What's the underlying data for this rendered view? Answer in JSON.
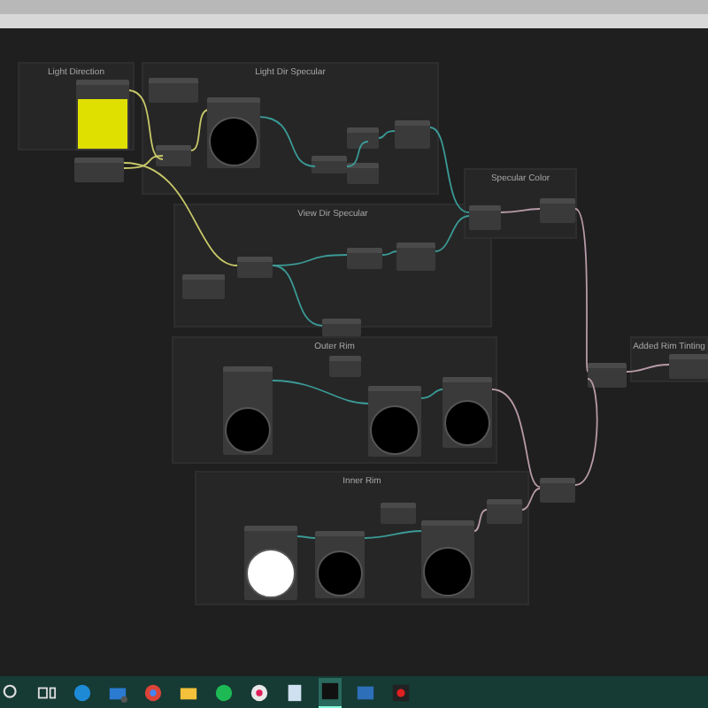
{
  "groups": [
    {
      "title": "Light Direction",
      "previews": [
        {
          "kind": "square",
          "color": "#e0e000"
        }
      ]
    },
    {
      "title": "Light Dir Specular",
      "previews": [
        {
          "kind": "circle",
          "color": "#000000"
        }
      ]
    },
    {
      "title": "View Dir Specular"
    },
    {
      "title": "Specular Color"
    },
    {
      "title": "Outer Rim",
      "previews": [
        {
          "kind": "circle",
          "color": "#000000"
        },
        {
          "kind": "circle",
          "color": "#000000"
        },
        {
          "kind": "circle",
          "color": "#000000"
        }
      ]
    },
    {
      "title": "Inner Rim",
      "previews": [
        {
          "kind": "circle",
          "color": "#ffffff"
        },
        {
          "kind": "circle",
          "color": "#000000"
        },
        {
          "kind": "circle",
          "color": "#000000"
        }
      ]
    },
    {
      "title": "Added Rim Tinting"
    }
  ],
  "taskbar": [
    {
      "kind": "search",
      "selected": false
    },
    {
      "kind": "taskview",
      "selected": false
    },
    {
      "kind": "browser",
      "selected": false
    },
    {
      "kind": "mail",
      "selected": false
    },
    {
      "kind": "globe",
      "selected": false
    },
    {
      "kind": "folder",
      "selected": false
    },
    {
      "kind": "music",
      "selected": false
    },
    {
      "kind": "chat",
      "selected": false
    },
    {
      "kind": "note",
      "selected": false
    },
    {
      "kind": "editor",
      "selected": true
    },
    {
      "kind": "photo",
      "selected": false
    },
    {
      "kind": "record",
      "selected": false
    }
  ]
}
